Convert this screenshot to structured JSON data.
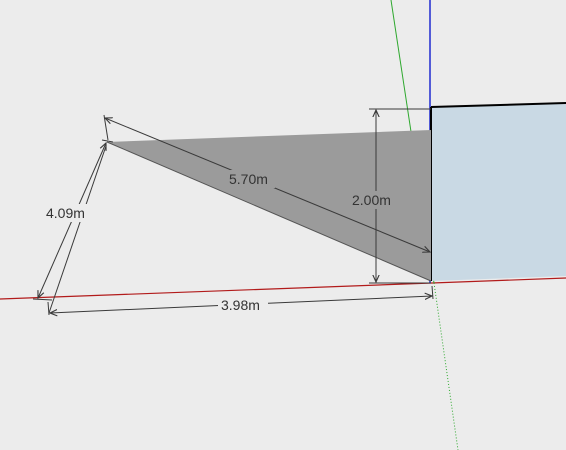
{
  "colors": {
    "background": "#ececec",
    "triangle_face": "#9b9b9b",
    "box_face": "#c9d9e4",
    "edge": "#000000",
    "axis_red": "#b21b1b",
    "axis_green": "#2ea82e",
    "axis_blue": "#1f2bd0",
    "dimension_line": "#3a3a3a"
  },
  "dimensions": {
    "hypotenuse": "5.70m",
    "height": "2.00m",
    "slant": "4.09m",
    "base": "3.98m"
  }
}
